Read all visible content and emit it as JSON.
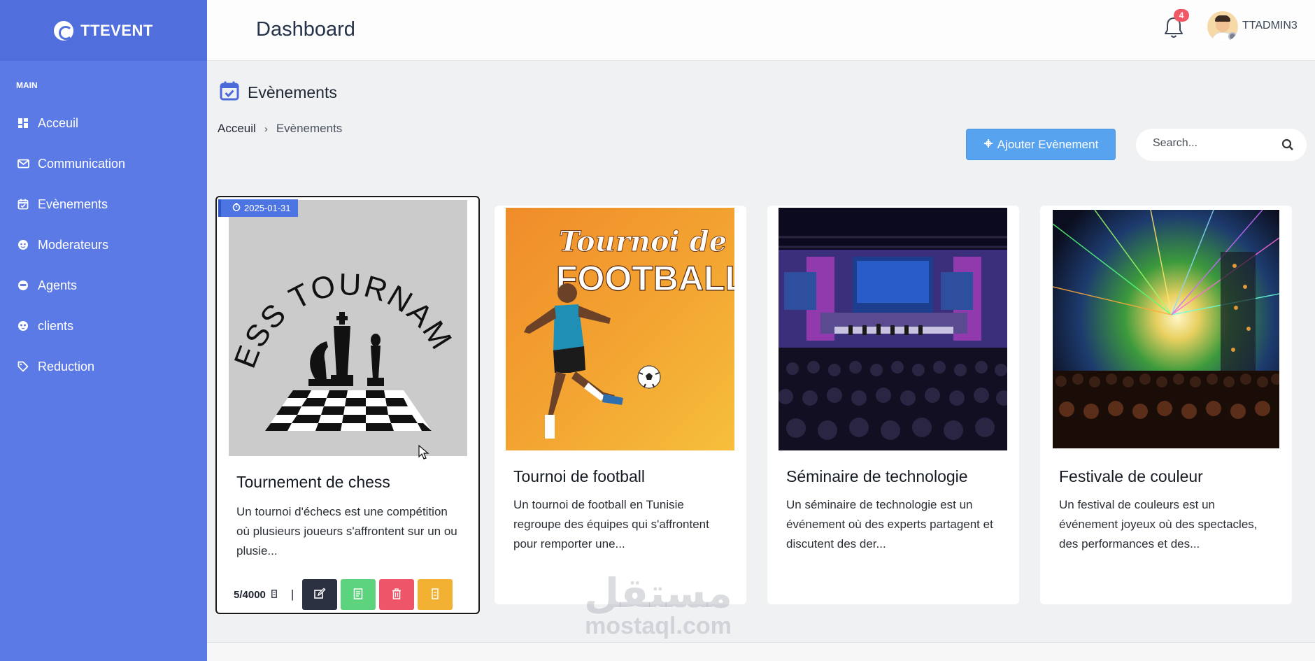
{
  "brand": {
    "name": "TTEVENT"
  },
  "sidebar": {
    "section_label": "MAIN",
    "items": [
      {
        "label": "Acceuil",
        "icon": "dashboard-icon"
      },
      {
        "label": "Communication",
        "icon": "mail-icon"
      },
      {
        "label": "Evènements",
        "icon": "calendar-check-icon"
      },
      {
        "label": "Moderateurs",
        "icon": "moderator-icon"
      },
      {
        "label": "Agents",
        "icon": "agent-icon"
      },
      {
        "label": "clients",
        "icon": "client-icon"
      },
      {
        "label": "Reduction",
        "icon": "tag-icon"
      }
    ]
  },
  "header": {
    "title": "Dashboard",
    "notification_count": "4",
    "user_name": "TTADMIN3"
  },
  "page": {
    "title": "Evènements",
    "breadcrumb": {
      "home": "Acceuil",
      "separator": "›",
      "current": "Evènements"
    },
    "add_button": "Ajouter Evènement",
    "search_placeholder": "Search..."
  },
  "events": [
    {
      "date": "2025-01-31",
      "title": "Tournement de chess",
      "description": "Un tournoi d'échecs est une compétition où plusieurs joueurs s'affrontent sur un ou plusie...",
      "count": "5/4000",
      "image_text": "CHESS TOURNAMENT"
    },
    {
      "title": "Tournoi de football",
      "description": "Un tournoi de football en Tunisie regroupe des équipes qui s'affrontent pour remporter une...",
      "image_text_1": "Tournoi de",
      "image_text_2": "FOOTBALL"
    },
    {
      "title": "Séminaire de technologie",
      "description": "Un séminaire de technologie est un événement où des experts partagent et discutent des der..."
    },
    {
      "title": "Festivale de couleur",
      "description": "Un festival de couleurs est un événement joyeux où des spectacles, des performances et des..."
    }
  ],
  "watermark": {
    "arabic": "مستقل",
    "latin": "mostaql.com"
  },
  "colors": {
    "sidebar": "#5c7ae6",
    "brand_bar": "#506fdc",
    "primary_button": "#57a3ef",
    "badge": "#ef5864",
    "edit": "#2b3141",
    "view": "#5ed37d",
    "delete": "#ee5568",
    "tickets": "#f2b133"
  }
}
